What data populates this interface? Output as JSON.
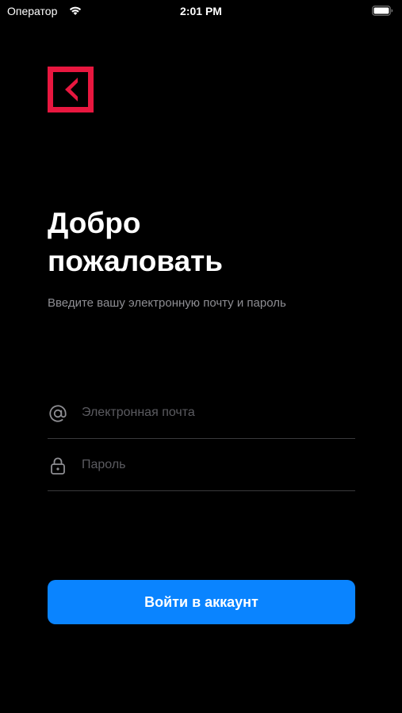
{
  "status_bar": {
    "carrier": "Оператор",
    "time": "2:01 PM",
    "wifi_icon": "wifi-icon",
    "battery_icon": "battery-full-icon"
  },
  "logo": {
    "icon": "back-arrow-logo",
    "color": "#e8173f"
  },
  "header": {
    "title_line1": "Добро",
    "title_line2": "пожаловать",
    "subtitle": "Введите вашу электронную почту и пароль"
  },
  "form": {
    "email": {
      "icon": "at-sign-icon",
      "placeholder": "Электронная почта",
      "value": ""
    },
    "password": {
      "icon": "lock-icon",
      "placeholder": "Пароль",
      "value": ""
    }
  },
  "actions": {
    "login_label": "Войти в аккаунт",
    "accent_color": "#0a84ff"
  }
}
